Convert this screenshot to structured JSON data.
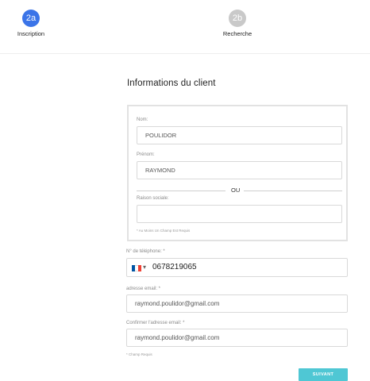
{
  "stepper": {
    "steps": [
      {
        "number": "2a",
        "label": "Inscription",
        "active": true
      },
      {
        "number": "2b",
        "label": "Recherche",
        "active": false
      }
    ]
  },
  "form": {
    "title": "Informations du client",
    "nom": {
      "label": "Nom:",
      "value": "POULIDOR"
    },
    "prenom": {
      "label": "Prénom:",
      "value": "RAYMOND"
    },
    "or_text": "OU",
    "raison_sociale": {
      "label": "Raison sociale:",
      "value": ""
    },
    "box_note": "* Au Moins Un Champ Est Requis",
    "phone": {
      "label": "N° de téléphone: *",
      "country": "FR",
      "value": "0678219065"
    },
    "email": {
      "label": "adresse email: *",
      "value": "raymond.poulidor@gmail.com"
    },
    "confirm_email": {
      "label": "Confirmer l'adresse email: *",
      "value": "raymond.poulidor@gmail.com"
    },
    "required_note": "* Champ Requis",
    "next_label": "SUIVANT"
  },
  "colors": {
    "step_active": "#3b74e8",
    "step_inactive": "#c9c9c9",
    "button": "#4fc7d4"
  }
}
